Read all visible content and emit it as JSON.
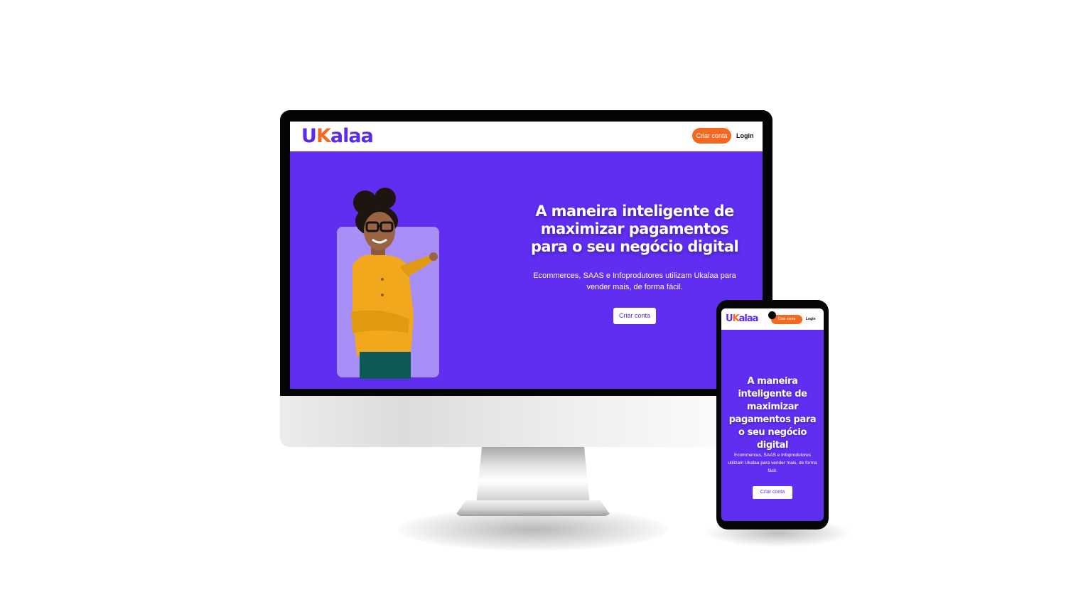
{
  "brand": {
    "logo_first": "U",
    "logo_k": "K",
    "logo_rest": "alaa",
    "primary_color": "#5f2ef0",
    "accent_color": "#f26a21"
  },
  "desktop": {
    "nav": {
      "cta_label": "Criar conta",
      "login_label": "Login"
    },
    "hero": {
      "headline": "A maneira inteligente de maximizar pagamentos para o seu negócio digital",
      "subtitle": "Ecommerces, SAAS e Infoprodutores utilizam Ukalaa para vender mais, de forma fácil.",
      "button_label": "Criar conta",
      "image_icon": "woman-pointing-photo"
    }
  },
  "mobile": {
    "nav": {
      "cta_label": "Criar conta",
      "login_label": "Login"
    },
    "hero": {
      "headline": "A maneira inteligente de maximizar pagamentos para o seu negócio digital",
      "subtitle": "Ecommerces, SAAS e Infoprodutores utilizam Ukalaa para vender mais, de forma fácil.",
      "button_label": "Criar conta"
    }
  }
}
